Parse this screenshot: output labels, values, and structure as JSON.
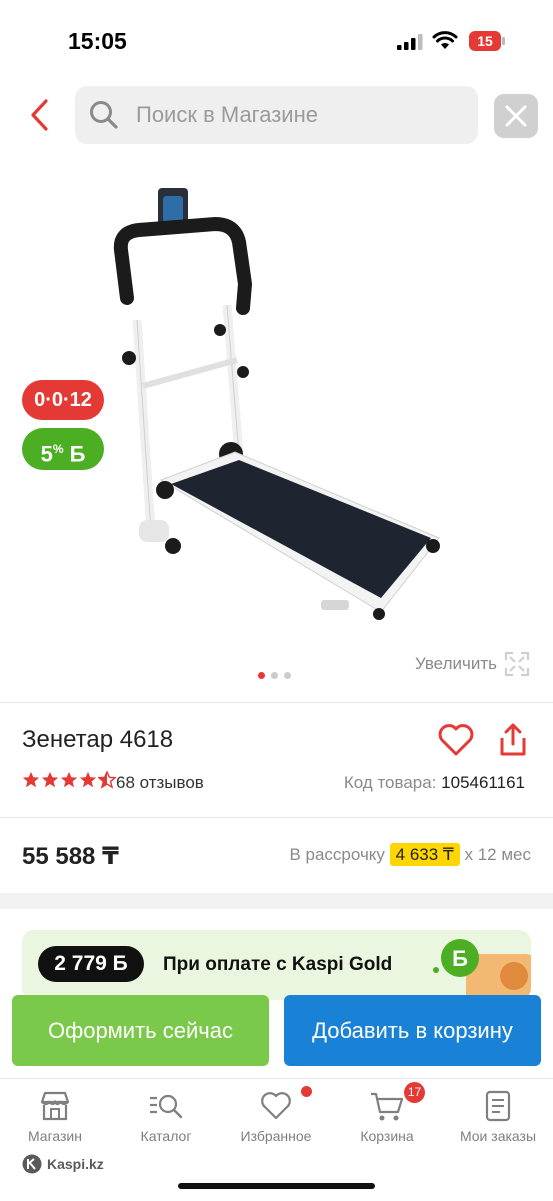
{
  "status_bar": {
    "time": "15:05",
    "battery": "15"
  },
  "header": {
    "search_placeholder": "Поиск в Магазине"
  },
  "badges": {
    "installment": "0·0·12",
    "bonus_percent": "5",
    "bonus_symbol": "Б"
  },
  "gallery": {
    "zoom_label": "Увеличить",
    "page_count": 3,
    "active_index": 0
  },
  "product": {
    "title": "Зенетар 4618",
    "rating": 4.5,
    "reviews": "68 отзывов",
    "code_label": "Код товара:",
    "code_value": "105461161",
    "price": "55 588 ₸",
    "installment_label": "В рассрочку",
    "installment_amount": "4 633 ₸",
    "installment_term": "х 12 мес"
  },
  "gold_banner": {
    "bonus": "2 779 Б",
    "text": "При оплате с Kaspi Gold"
  },
  "actions": {
    "buy_now": "Оформить сейчас",
    "add_to_cart": "Добавить в корзину"
  },
  "nav": {
    "items": [
      {
        "label": "Магазин",
        "icon": "shop-icon"
      },
      {
        "label": "Каталог",
        "icon": "catalog-search-icon"
      },
      {
        "label": "Избранное",
        "icon": "heart-icon"
      },
      {
        "label": "Корзина",
        "icon": "cart-icon"
      },
      {
        "label": "Мои заказы",
        "icon": "orders-icon"
      }
    ],
    "cart_count": "17"
  },
  "footer": {
    "logo_text": "Kaspi.kz"
  },
  "colors": {
    "accent_red": "#e53935",
    "green": "#7bc94a",
    "blue": "#1a82d6",
    "installment_yellow": "#ffd600"
  }
}
